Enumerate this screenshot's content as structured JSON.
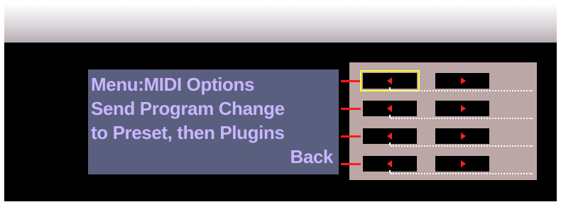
{
  "lcd": {
    "lines": [
      "Menu:MIDI Options",
      "Send Program Change",
      "to Preset, then Plugins",
      "Back"
    ]
  },
  "controls": {
    "rows": [
      {
        "left_button": "decrement",
        "right_button": "increment",
        "selected": "left"
      },
      {
        "left_button": "decrement",
        "right_button": "increment",
        "selected": null
      },
      {
        "left_button": "decrement",
        "right_button": "increment",
        "selected": null
      },
      {
        "left_button": "decrement",
        "right_button": "increment",
        "selected": null
      }
    ]
  },
  "colors": {
    "lcd_background": "#5a5f7f",
    "lcd_text": "#c8b6ff",
    "panel_background": "#bba7a5",
    "arrow": "#ff2020",
    "selection_outline": "#ffff33"
  }
}
